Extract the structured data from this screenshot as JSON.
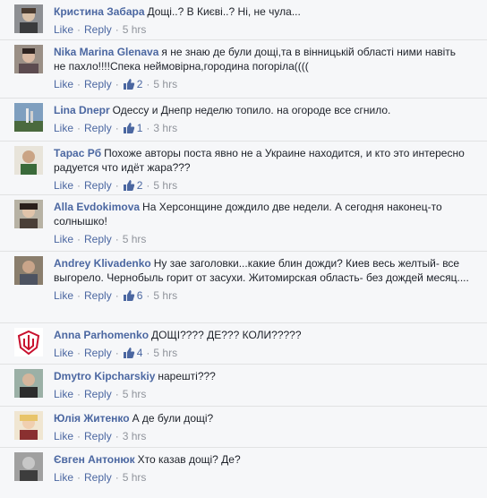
{
  "ui": {
    "like_label": "Like",
    "reply_label": "Reply",
    "separator": "·",
    "accent_color": "#4b67a1",
    "meta_color": "#90949c"
  },
  "comments": [
    {
      "author": "Кристина Забара",
      "text": "Дощі..? В Києві..? Ні, не чула...",
      "likes": "",
      "time": "5 hrs",
      "avatar_icon": "user-photo-icon"
    },
    {
      "author": "Nika Marina Glenava",
      "text": "я не знаю де були дощі,та в вінницькій області ними навіть не пахло!!!!Спека неймовірна,городина погоріла((((",
      "likes": "2",
      "time": "5 hrs",
      "avatar_icon": "user-photo-icon"
    },
    {
      "author": "Lina Dnepr",
      "text": "Одессу и Днепр неделю топило. на огороде все сгнило.",
      "likes": "1",
      "time": "3 hrs",
      "avatar_icon": "user-photo-icon"
    },
    {
      "author": "Тарас Рб",
      "text": "Похоже авторы поста явно не а Украине находится, и кто это интересно радуется что идёт жара???",
      "likes": "2",
      "time": "5 hrs",
      "avatar_icon": "user-photo-icon"
    },
    {
      "author": "Alla Evdokimova",
      "text": "На Херсонщине дождило две недели. А сегодня наконец-то солнышко!",
      "likes": "",
      "time": "5 hrs",
      "avatar_icon": "user-photo-icon"
    },
    {
      "author": "Andrey Klivadenko",
      "text": "Ну зае заголовки...какие блин дожди? Киев весь желтый- все выгорело. Чернобыль горит от засухи. Житомирская область- без дождей месяц....",
      "likes": "6",
      "time": "5 hrs",
      "avatar_icon": "user-photo-icon"
    },
    {
      "author": "Anna Parhomenko",
      "text": "ДОЩІ???? ДЕ??? КОЛИ?????",
      "likes": "4",
      "time": "5 hrs",
      "avatar_icon": "trident-emblem-icon"
    },
    {
      "author": "Dmytro Kipcharskiy",
      "text": "нарешті???",
      "likes": "",
      "time": "5 hrs",
      "avatar_icon": "user-photo-icon"
    },
    {
      "author": "Юлія Житенко",
      "text": "А де були дощі?",
      "likes": "",
      "time": "3 hrs",
      "avatar_icon": "user-photo-icon"
    },
    {
      "author": "Євген Антонюк",
      "text": "Хто казав дощі? Де?",
      "likes": "",
      "time": "5 hrs",
      "avatar_icon": "user-photo-icon"
    }
  ]
}
